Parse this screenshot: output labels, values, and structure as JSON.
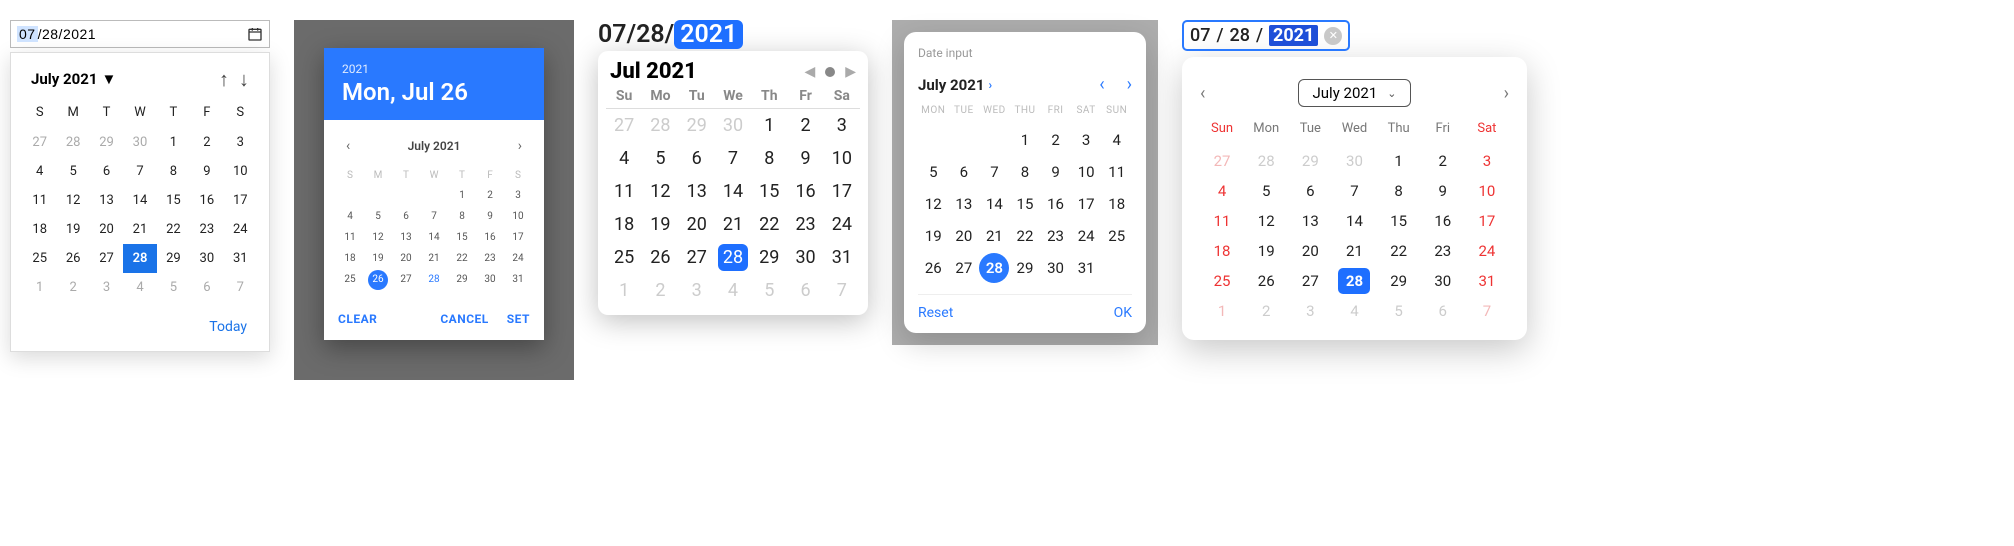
{
  "p1": {
    "input": {
      "mm": "07",
      "dd": "28",
      "yyyy": "2021",
      "sep": "/"
    },
    "title": "July 2021",
    "dow": [
      "S",
      "M",
      "T",
      "W",
      "T",
      "F",
      "S"
    ],
    "days": [
      {
        "n": "27",
        "o": 1
      },
      {
        "n": "28",
        "o": 1
      },
      {
        "n": "29",
        "o": 1
      },
      {
        "n": "30",
        "o": 1
      },
      {
        "n": "1"
      },
      {
        "n": "2"
      },
      {
        "n": "3"
      },
      {
        "n": "4"
      },
      {
        "n": "5"
      },
      {
        "n": "6"
      },
      {
        "n": "7"
      },
      {
        "n": "8"
      },
      {
        "n": "9"
      },
      {
        "n": "10"
      },
      {
        "n": "11"
      },
      {
        "n": "12"
      },
      {
        "n": "13"
      },
      {
        "n": "14"
      },
      {
        "n": "15"
      },
      {
        "n": "16"
      },
      {
        "n": "17"
      },
      {
        "n": "18"
      },
      {
        "n": "19"
      },
      {
        "n": "20"
      },
      {
        "n": "21"
      },
      {
        "n": "22"
      },
      {
        "n": "23"
      },
      {
        "n": "24"
      },
      {
        "n": "25"
      },
      {
        "n": "26"
      },
      {
        "n": "27"
      },
      {
        "n": "28",
        "s": 1
      },
      {
        "n": "29"
      },
      {
        "n": "30"
      },
      {
        "n": "31"
      },
      {
        "n": "1",
        "o": 1
      },
      {
        "n": "2",
        "o": 1
      },
      {
        "n": "3",
        "o": 1
      },
      {
        "n": "4",
        "o": 1
      },
      {
        "n": "5",
        "o": 1
      },
      {
        "n": "6",
        "o": 1
      },
      {
        "n": "7",
        "o": 1
      }
    ],
    "today": "Today"
  },
  "p2": {
    "year": "2021",
    "header_date": "Mon, Jul 26",
    "title": "July 2021",
    "dow": [
      "S",
      "M",
      "T",
      "W",
      "T",
      "F",
      "S"
    ],
    "days": [
      {
        "b": 1
      },
      {
        "b": 1
      },
      {
        "b": 1
      },
      {
        "b": 1
      },
      {
        "n": "1"
      },
      {
        "n": "2"
      },
      {
        "n": "3"
      },
      {
        "n": "4"
      },
      {
        "n": "5"
      },
      {
        "n": "6"
      },
      {
        "n": "7"
      },
      {
        "n": "8"
      },
      {
        "n": "9"
      },
      {
        "n": "10"
      },
      {
        "n": "11"
      },
      {
        "n": "12"
      },
      {
        "n": "13"
      },
      {
        "n": "14"
      },
      {
        "n": "15"
      },
      {
        "n": "16"
      },
      {
        "n": "17"
      },
      {
        "n": "18"
      },
      {
        "n": "19"
      },
      {
        "n": "20"
      },
      {
        "n": "21"
      },
      {
        "n": "22"
      },
      {
        "n": "23"
      },
      {
        "n": "24"
      },
      {
        "n": "25"
      },
      {
        "n": "26",
        "s": 1
      },
      {
        "n": "27"
      },
      {
        "n": "28",
        "blue": 1
      },
      {
        "n": "29"
      },
      {
        "n": "30"
      },
      {
        "n": "31"
      }
    ],
    "actions": {
      "clear": "CLEAR",
      "cancel": "CANCEL",
      "set": "SET"
    }
  },
  "p3": {
    "input": {
      "mm": "07",
      "dd": "28",
      "yyyy": "2021",
      "sep": "/"
    },
    "title": "Jul 2021",
    "dow": [
      "Su",
      "Mo",
      "Tu",
      "We",
      "Th",
      "Fr",
      "Sa"
    ],
    "days": [
      {
        "n": "27",
        "o": 1
      },
      {
        "n": "28",
        "o": 1
      },
      {
        "n": "29",
        "o": 1
      },
      {
        "n": "30",
        "o": 1
      },
      {
        "n": "1"
      },
      {
        "n": "2"
      },
      {
        "n": "3"
      },
      {
        "n": "4"
      },
      {
        "n": "5"
      },
      {
        "n": "6"
      },
      {
        "n": "7"
      },
      {
        "n": "8"
      },
      {
        "n": "9"
      },
      {
        "n": "10"
      },
      {
        "n": "11"
      },
      {
        "n": "12"
      },
      {
        "n": "13"
      },
      {
        "n": "14"
      },
      {
        "n": "15"
      },
      {
        "n": "16"
      },
      {
        "n": "17"
      },
      {
        "n": "18"
      },
      {
        "n": "19"
      },
      {
        "n": "20"
      },
      {
        "n": "21"
      },
      {
        "n": "22"
      },
      {
        "n": "23"
      },
      {
        "n": "24"
      },
      {
        "n": "25"
      },
      {
        "n": "26"
      },
      {
        "n": "27"
      },
      {
        "n": "28",
        "s": 1
      },
      {
        "n": "29"
      },
      {
        "n": "30"
      },
      {
        "n": "31"
      },
      {
        "n": "1",
        "o": 1
      },
      {
        "n": "2",
        "o": 1
      },
      {
        "n": "3",
        "o": 1
      },
      {
        "n": "4",
        "o": 1
      },
      {
        "n": "5",
        "o": 1
      },
      {
        "n": "6",
        "o": 1
      },
      {
        "n": "7",
        "o": 1
      }
    ]
  },
  "p4": {
    "label": "Date input",
    "title": "July 2021",
    "dow": [
      "MON",
      "TUE",
      "WED",
      "THU",
      "FRI",
      "SAT",
      "SUN"
    ],
    "days": [
      {
        "b": 1
      },
      {
        "b": 1
      },
      {
        "b": 1
      },
      {
        "n": "1"
      },
      {
        "n": "2"
      },
      {
        "n": "3"
      },
      {
        "n": "4"
      },
      {
        "n": "5"
      },
      {
        "n": "6"
      },
      {
        "n": "7"
      },
      {
        "n": "8"
      },
      {
        "n": "9"
      },
      {
        "n": "10"
      },
      {
        "n": "11"
      },
      {
        "n": "12"
      },
      {
        "n": "13"
      },
      {
        "n": "14"
      },
      {
        "n": "15"
      },
      {
        "n": "16"
      },
      {
        "n": "17"
      },
      {
        "n": "18"
      },
      {
        "n": "19"
      },
      {
        "n": "20"
      },
      {
        "n": "21"
      },
      {
        "n": "22"
      },
      {
        "n": "23"
      },
      {
        "n": "24"
      },
      {
        "n": "25"
      },
      {
        "n": "26"
      },
      {
        "n": "27"
      },
      {
        "n": "28",
        "s": 1
      },
      {
        "n": "29"
      },
      {
        "n": "30"
      },
      {
        "n": "31"
      },
      {
        "b": 1
      }
    ],
    "actions": {
      "reset": "Reset",
      "ok": "OK"
    }
  },
  "p5": {
    "input": {
      "mm": "07",
      "dd": "28",
      "yyyy": "2021",
      "sep": " / "
    },
    "title": "July 2021",
    "dow": [
      "Sun",
      "Mon",
      "Tue",
      "Wed",
      "Thu",
      "Fri",
      "Sat"
    ],
    "days": [
      {
        "n": "27",
        "o": 1,
        "r": 1
      },
      {
        "n": "28",
        "o": 1
      },
      {
        "n": "29",
        "o": 1
      },
      {
        "n": "30",
        "o": 1
      },
      {
        "n": "1"
      },
      {
        "n": "2"
      },
      {
        "n": "3",
        "r": 1
      },
      {
        "n": "4",
        "r": 1
      },
      {
        "n": "5"
      },
      {
        "n": "6"
      },
      {
        "n": "7"
      },
      {
        "n": "8"
      },
      {
        "n": "9"
      },
      {
        "n": "10",
        "r": 1
      },
      {
        "n": "11",
        "r": 1
      },
      {
        "n": "12"
      },
      {
        "n": "13"
      },
      {
        "n": "14"
      },
      {
        "n": "15"
      },
      {
        "n": "16"
      },
      {
        "n": "17",
        "r": 1
      },
      {
        "n": "18",
        "r": 1
      },
      {
        "n": "19"
      },
      {
        "n": "20"
      },
      {
        "n": "21"
      },
      {
        "n": "22"
      },
      {
        "n": "23"
      },
      {
        "n": "24",
        "r": 1
      },
      {
        "n": "25",
        "r": 1
      },
      {
        "n": "26"
      },
      {
        "n": "27"
      },
      {
        "n": "28",
        "s": 1
      },
      {
        "n": "29"
      },
      {
        "n": "30"
      },
      {
        "n": "31",
        "r": 1
      },
      {
        "n": "1",
        "o": 1,
        "r": 1
      },
      {
        "n": "2",
        "o": 1
      },
      {
        "n": "3",
        "o": 1
      },
      {
        "n": "4",
        "o": 1
      },
      {
        "n": "5",
        "o": 1
      },
      {
        "n": "6",
        "o": 1
      },
      {
        "n": "7",
        "o": 1,
        "r": 1
      }
    ]
  }
}
